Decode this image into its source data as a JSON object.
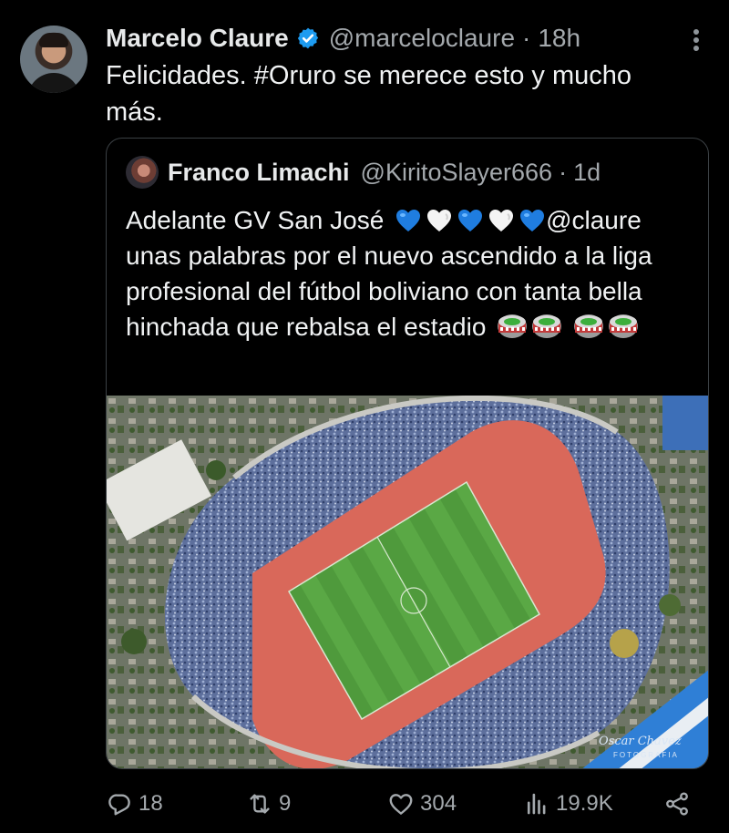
{
  "author": {
    "name": "Marcelo Claure",
    "handle": "@marceloclaure",
    "separator": "·",
    "time": "18h",
    "text": "Felicidades. #Oruro se merece esto y mucho más."
  },
  "quoted": {
    "name": "Franco Limachi",
    "handle": "@KiritoSlayer666",
    "separator": "·",
    "time": "1d",
    "text_intro": "Adelante GV San José",
    "text_mention": "@claure",
    "text_body": "unas palabras por el nuevo ascendido a la liga profesional del fútbol boliviano con tanta bella hinchada que rebalsa el estadio",
    "emojis": [
      "blue-heart",
      "white-heart",
      "blue-heart",
      "white-heart",
      "blue-heart",
      "stadium",
      "stadium",
      "stadium",
      "stadium"
    ],
    "photo_signature": "Oscar Chavez",
    "photo_credit": "FOTOGRAFIA"
  },
  "actions": {
    "replies": "18",
    "reposts": "9",
    "likes": "304",
    "views": "19.9K"
  },
  "colors": {
    "background": "#000000",
    "text": "#e7e9ea",
    "muted": "#a4a9ad",
    "verified": "#1d9bf0",
    "quote_border": "#3b4044"
  }
}
